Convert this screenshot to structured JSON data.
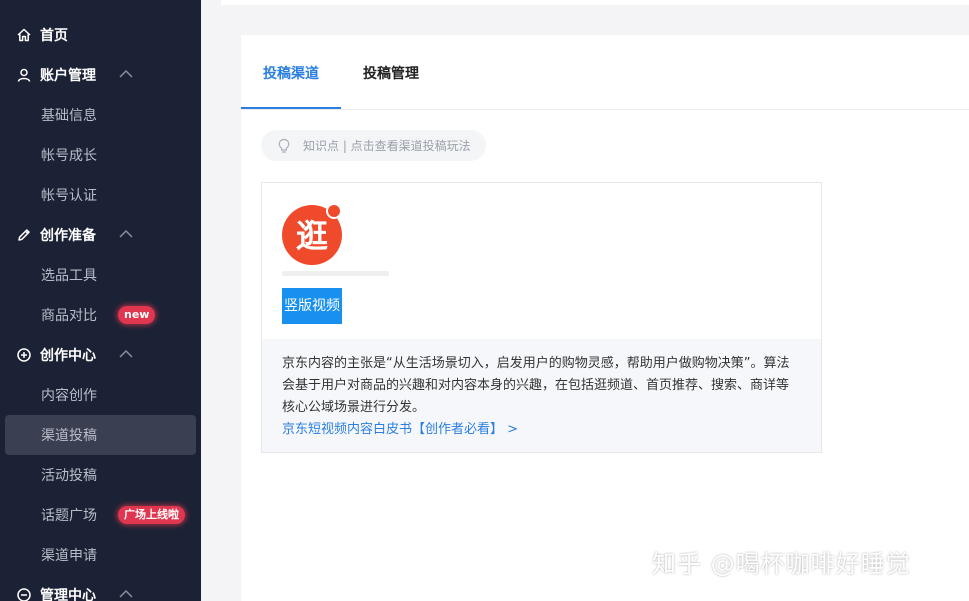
{
  "sidebar": {
    "items": [
      {
        "label": "首页",
        "type": "top",
        "icon": "home-icon"
      },
      {
        "label": "账户管理",
        "type": "top",
        "icon": "user-icon",
        "expanded": true
      },
      {
        "label": "基础信息",
        "type": "sub"
      },
      {
        "label": "帐号成长",
        "type": "sub"
      },
      {
        "label": "帐号认证",
        "type": "sub"
      },
      {
        "label": "创作准备",
        "type": "top",
        "icon": "pencil-icon",
        "expanded": true
      },
      {
        "label": "选品工具",
        "type": "sub"
      },
      {
        "label": "商品对比",
        "type": "sub",
        "badge": "new"
      },
      {
        "label": "创作中心",
        "type": "top",
        "icon": "plus-circle-icon",
        "expanded": true
      },
      {
        "label": "内容创作",
        "type": "sub"
      },
      {
        "label": "渠道投稿",
        "type": "sub",
        "active": true
      },
      {
        "label": "活动投稿",
        "type": "sub"
      },
      {
        "label": "话题广场",
        "type": "sub",
        "badge": "广场上线啦"
      },
      {
        "label": "渠道申请",
        "type": "sub"
      },
      {
        "label": "管理中心",
        "type": "top",
        "icon": "minus-circle-icon",
        "expanded": true
      }
    ]
  },
  "tabs": [
    {
      "label": "投稿渠道",
      "active": true
    },
    {
      "label": "投稿管理",
      "active": false
    }
  ],
  "tip": {
    "text": "知识点 | 点击查看渠道投稿玩法"
  },
  "card": {
    "logo_char": "逛",
    "button_label": "竖版视频",
    "description": "京东内容的主张是“从生活场景切入，启发用户的购物灵感，帮助用户做购物决策”。算法会基于用户对商品的兴趣和对内容本身的兴趣，在包括逛频道、首页推荐、搜索、商详等核心公域场景进行分发。",
    "link": "京东短视频内容白皮书【创作者必看】 >"
  },
  "watermark": "知乎 @喝杯咖啡好睡觉",
  "colors": {
    "sidebar_bg": "#1c2236",
    "accent": "#2b7fe0",
    "button": "#1890f0",
    "badge": "#e0364f",
    "logo": "#f04a2c"
  }
}
